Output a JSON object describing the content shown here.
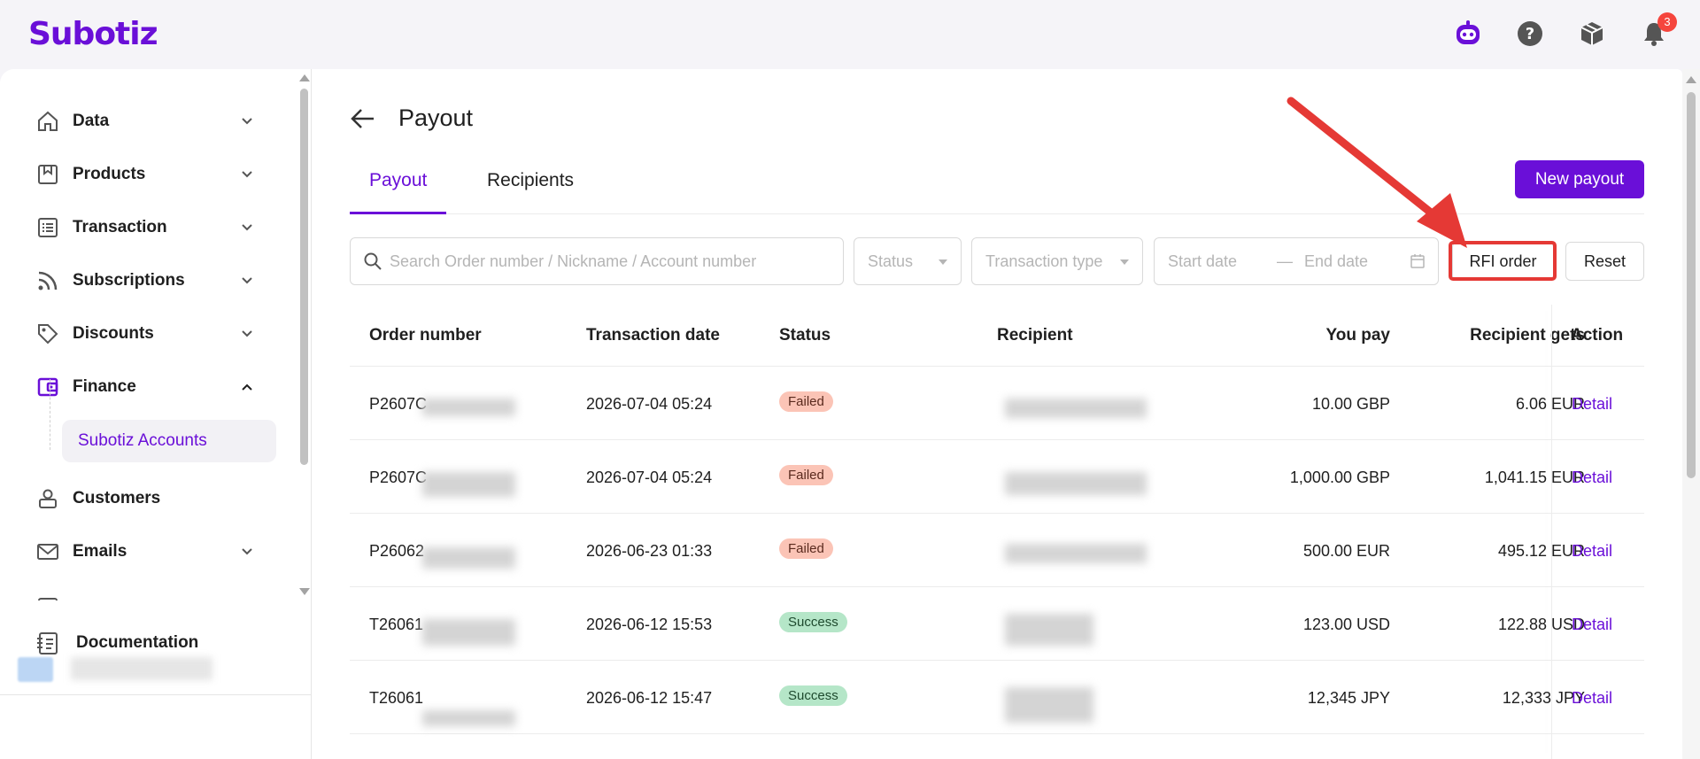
{
  "app": {
    "logo_text": "Subotiz",
    "accent_color": "#6a0fd8",
    "notification_count": "3"
  },
  "topbar": {
    "icons": [
      "assistant-bot-icon",
      "help-icon",
      "package-icon",
      "bell-icon"
    ]
  },
  "sidebar": {
    "items": [
      {
        "label": "Data",
        "icon": "home-icon",
        "expanded": false
      },
      {
        "label": "Products",
        "icon": "product-icon",
        "expanded": false
      },
      {
        "label": "Transaction",
        "icon": "list-icon",
        "expanded": false
      },
      {
        "label": "Subscriptions",
        "icon": "rss-icon",
        "expanded": false
      },
      {
        "label": "Discounts",
        "icon": "tag-icon",
        "expanded": false
      },
      {
        "label": "Finance",
        "icon": "wallet-icon",
        "expanded": true
      },
      {
        "label": "Customers",
        "icon": "user-icon",
        "expanded": false
      },
      {
        "label": "Emails",
        "icon": "mail-icon",
        "expanded": false
      }
    ],
    "subitem_finance": "Subotiz Accounts",
    "documentation": "Documentation"
  },
  "page": {
    "title": "Payout",
    "tabs": [
      "Payout",
      "Recipients"
    ],
    "active_tab": "Payout",
    "new_button": "New payout"
  },
  "filters": {
    "search_placeholder": "Search Order number / Nickname / Account number",
    "status_placeholder": "Status",
    "type_placeholder": "Transaction type",
    "start_date": "Start date",
    "date_sep": "—",
    "end_date": "End date",
    "rfi_button": "RFI order",
    "reset_button": "Reset"
  },
  "table": {
    "columns": [
      "Order number",
      "Transaction date",
      "Status",
      "Recipient",
      "You pay",
      "Recipient gets",
      "Action"
    ],
    "rows": [
      {
        "order": "P2607C",
        "date": "2026-07-04 05:24",
        "status": "Failed",
        "you_pay": "10.00 GBP",
        "gets": "6.06 EUR",
        "action": "Detail"
      },
      {
        "order": "P2607C",
        "date": "2026-07-04 05:24",
        "status": "Failed",
        "you_pay": "1,000.00 GBP",
        "gets": "1,041.15 EUR",
        "action": "Detail"
      },
      {
        "order": "P26062",
        "date": "2026-06-23 01:33",
        "status": "Failed",
        "you_pay": "500.00 EUR",
        "gets": "495.12 EUR",
        "action": "Detail"
      },
      {
        "order": "T26061",
        "date": "2026-06-12 15:53",
        "status": "Success",
        "you_pay": "123.00 USD",
        "gets": "122.88 USD",
        "action": "Detail"
      },
      {
        "order": "T26061",
        "date": "2026-06-12 15:47",
        "status": "Success",
        "you_pay": "12,345 JPY",
        "gets": "12,333 JPY",
        "action": "Detail"
      }
    ]
  }
}
